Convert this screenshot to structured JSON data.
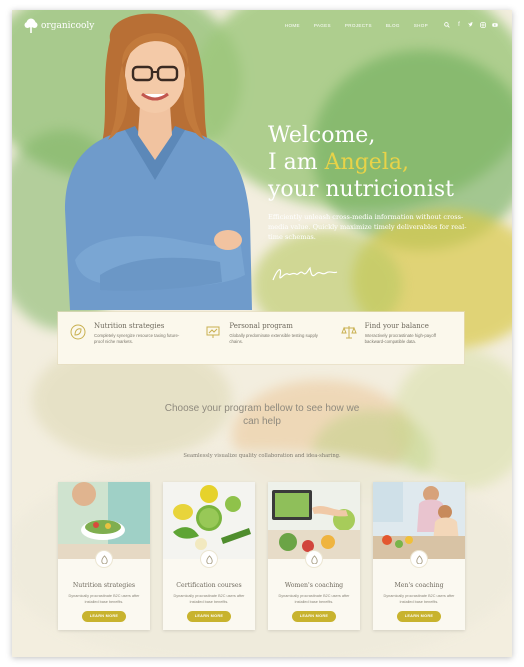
{
  "brand": {
    "name": "organicooly"
  },
  "nav": {
    "items": [
      "HOME",
      "PAGES",
      "PROJECTS",
      "BLOG",
      "SHOP"
    ],
    "icons": [
      "search-icon",
      "facebook-icon",
      "twitter-icon",
      "instagram-icon",
      "youtube-icon"
    ]
  },
  "hero": {
    "line1": "Welcome,",
    "line2_pre": "I am ",
    "line2_name": "Angela,",
    "line3": "your nutricionist",
    "description": "Efficiently unleash cross-media information without cross-media value. Quickly maximize timely deliverables for real-time schemas."
  },
  "features": [
    {
      "icon": "leaf-icon",
      "title": "Nutrition strategies",
      "text": "Completely synergize resource taxing future-proof niche markets."
    },
    {
      "icon": "presentation-icon",
      "title": "Personal program",
      "text": "Globally predominate extensible testing supply chains."
    },
    {
      "icon": "scale-icon",
      "title": "Find your balance",
      "text": "Interactively procrastinate high-payoff backward-compatible data."
    }
  ],
  "program": {
    "title": "Choose your program bellow to see how we can help",
    "subtitle": "Seamlessly visualize quality collaboration and idea-sharing."
  },
  "cards": [
    {
      "title": "Nutrition strategies",
      "text": "Dynamically procrastinate B2C users after installed base benefits.",
      "button": "LEARN MORE"
    },
    {
      "title": "Certification courses",
      "text": "Dynamically procrastinate B2C users after installed base benefits.",
      "button": "LEARN MORE"
    },
    {
      "title": "Women's coaching",
      "text": "Dynamically procrastinate B2C users after installed base benefits.",
      "button": "LEARN MORE"
    },
    {
      "title": "Men's coaching",
      "text": "Dynamically procrastinate B2C users after installed base benefits.",
      "button": "LEARN MORE"
    }
  ],
  "colors": {
    "accent": "#c8b32e",
    "name_highlight": "#e8d348",
    "strip_bg": "#fbf8ec"
  }
}
